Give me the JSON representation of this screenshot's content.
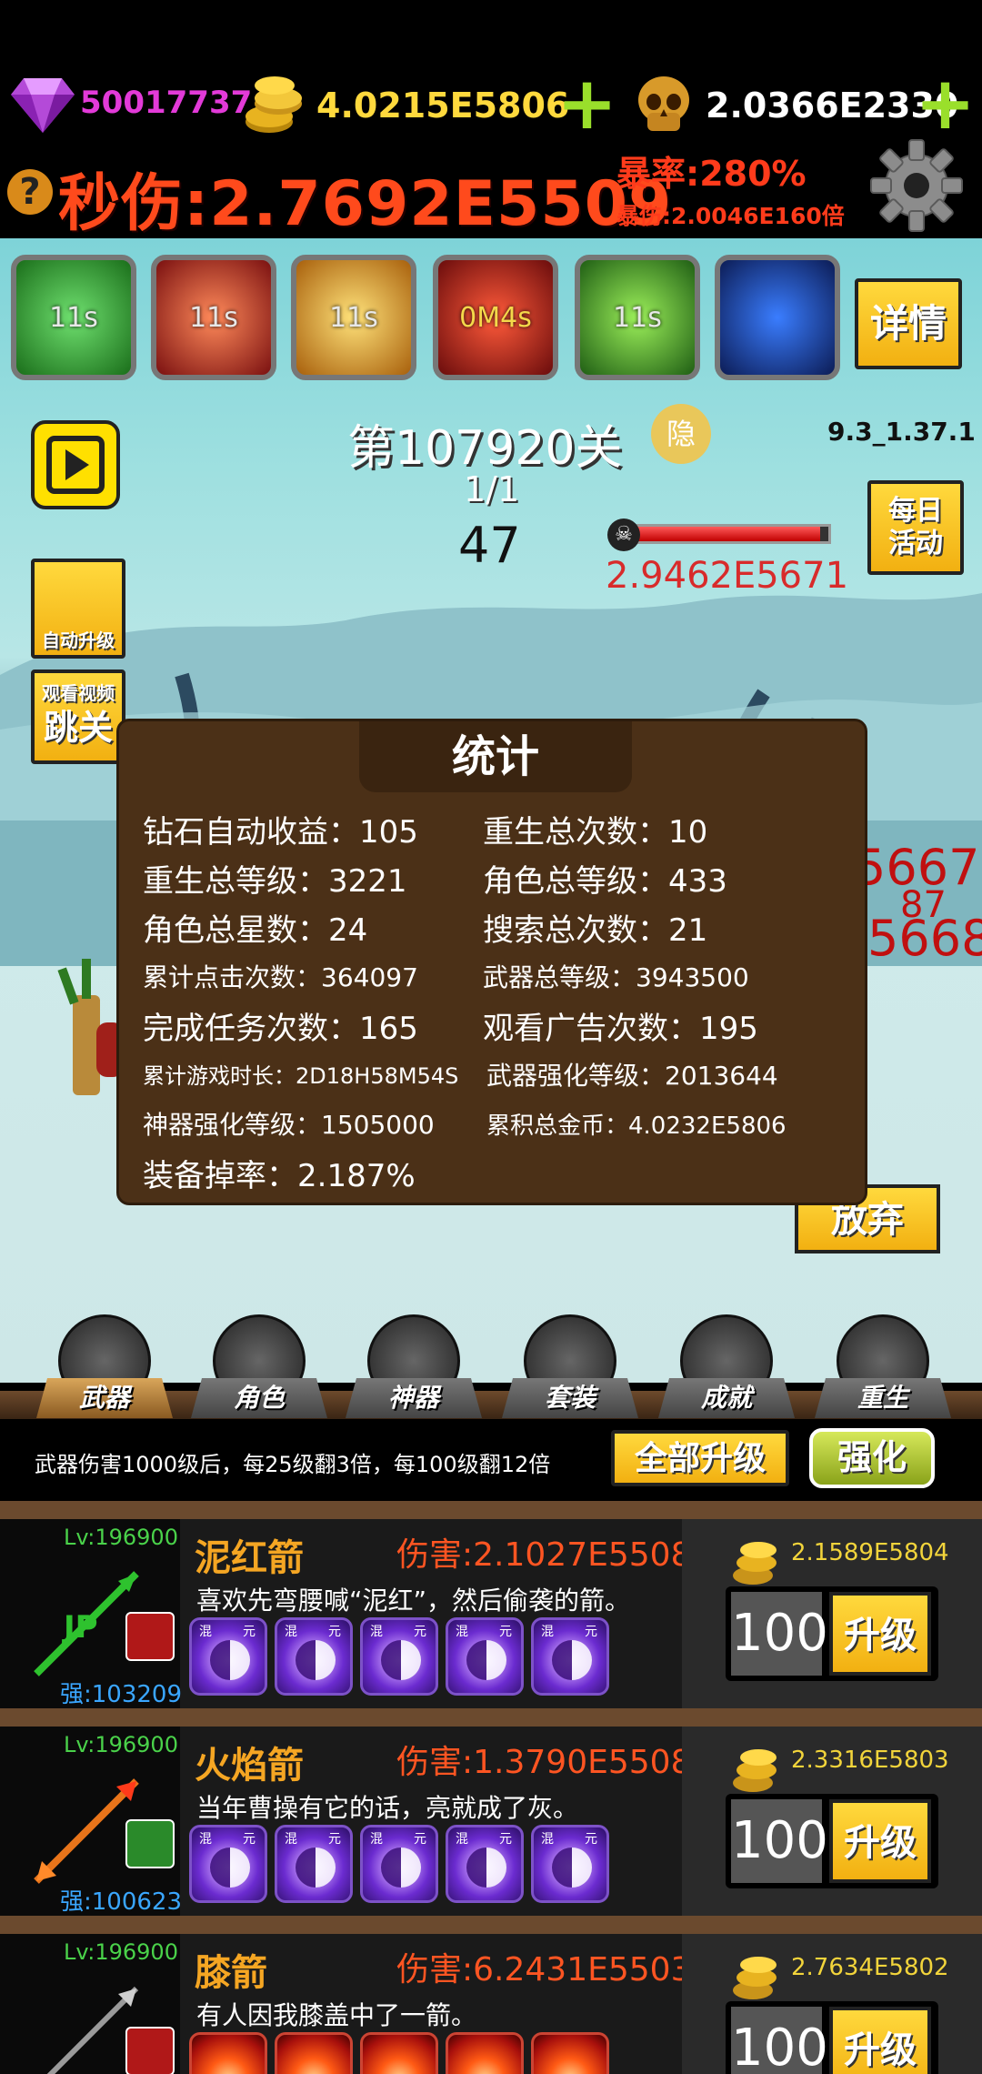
{
  "hud": {
    "diamonds": "50017737",
    "gold": "4.0215E5806",
    "souls": "2.0366E2330",
    "dps_label": "秒伤:",
    "dps_value": "2.7692E5509",
    "crit_rate": "暴率:280%",
    "crit_damage": "暴伤:2.0046E160倍",
    "help": "?"
  },
  "skills": [
    {
      "timer": "11s",
      "color": "#2fb33b"
    },
    {
      "timer": "11s",
      "color": "#d23a20"
    },
    {
      "timer": "11s",
      "color": "#e8a01a"
    },
    {
      "timer": "0M4s",
      "color": "#c8281c"
    },
    {
      "timer": "11s",
      "color": "#3aa63a"
    },
    {
      "timer": "",
      "color": "#1f4fbf"
    }
  ],
  "details_button": "详情",
  "stage": {
    "title": "第107920关",
    "hide": "隐",
    "version": "9.3_1.37.1",
    "wave": "1/1",
    "count": "47",
    "boss_hp": "2.9462E5671",
    "boss_hp_fraction": 0.96
  },
  "side_buttons": {
    "daily_line1": "每日",
    "daily_line2": "活动",
    "auto_upgrade": "自动升级",
    "watch_video": "观看视频",
    "skip_level": "跳关",
    "give_up": "放弃"
  },
  "bg_damage_numbers": [
    "5667",
    "87",
    "5668"
  ],
  "stats": {
    "title": "统计",
    "items": [
      {
        "label": "钻石自动收益：105"
      },
      {
        "label": "重生总次数：10"
      },
      {
        "label": "重生总等级：3221"
      },
      {
        "label": "角色总等级：433"
      },
      {
        "label": "角色总星数：24"
      },
      {
        "label": "搜索总次数：21"
      },
      {
        "label": "累计点击次数：364097"
      },
      {
        "label": "武器总等级：3943500"
      },
      {
        "label": "完成任务次数：165"
      },
      {
        "label": "观看广告次数：195"
      },
      {
        "label": "累计游戏时长：2D18H58M54S"
      },
      {
        "label": "武器强化等级：2013644"
      },
      {
        "label": "神器强化等级：1505000"
      },
      {
        "label": "累积总金币：4.0232E5806"
      },
      {
        "label": "装备掉率：2.187%"
      }
    ]
  },
  "tabs": [
    "武器",
    "角色",
    "神器",
    "套装",
    "成就",
    "重生"
  ],
  "info": {
    "text": "武器伤害1000级后，每25级翻3倍，每100级翻12倍",
    "upgrade_all": "全部升级",
    "enhance": "强化"
  },
  "weapons": [
    {
      "lv": "Lv:196900",
      "name": "泥红箭",
      "damage_label": "伤害:",
      "damage": "2.1027E5508",
      "desc": "喜欢先弯腰喊“泥红”，然后偷袭的箭。",
      "qiang": "强:103209",
      "price": "2.1589E5804",
      "count": "100",
      "upgrade": "升级"
    },
    {
      "lv": "Lv:196900",
      "name": "火焰箭",
      "damage_label": "伤害:",
      "damage": "1.3790E5508",
      "desc": "当年曹操有它的话，亮就成了灰。",
      "qiang": "强:100623",
      "price": "2.3316E5803",
      "count": "100",
      "upgrade": "升级"
    },
    {
      "lv": "Lv:196900",
      "name": "膝箭",
      "damage_label": "伤害:",
      "damage": "6.2431E5503",
      "desc": "有人因我膝盖中了一箭。",
      "qiang": "",
      "price": "2.7634E5802",
      "count": "100",
      "upgrade": "升级"
    }
  ],
  "orb_tags": [
    "混",
    "元"
  ]
}
